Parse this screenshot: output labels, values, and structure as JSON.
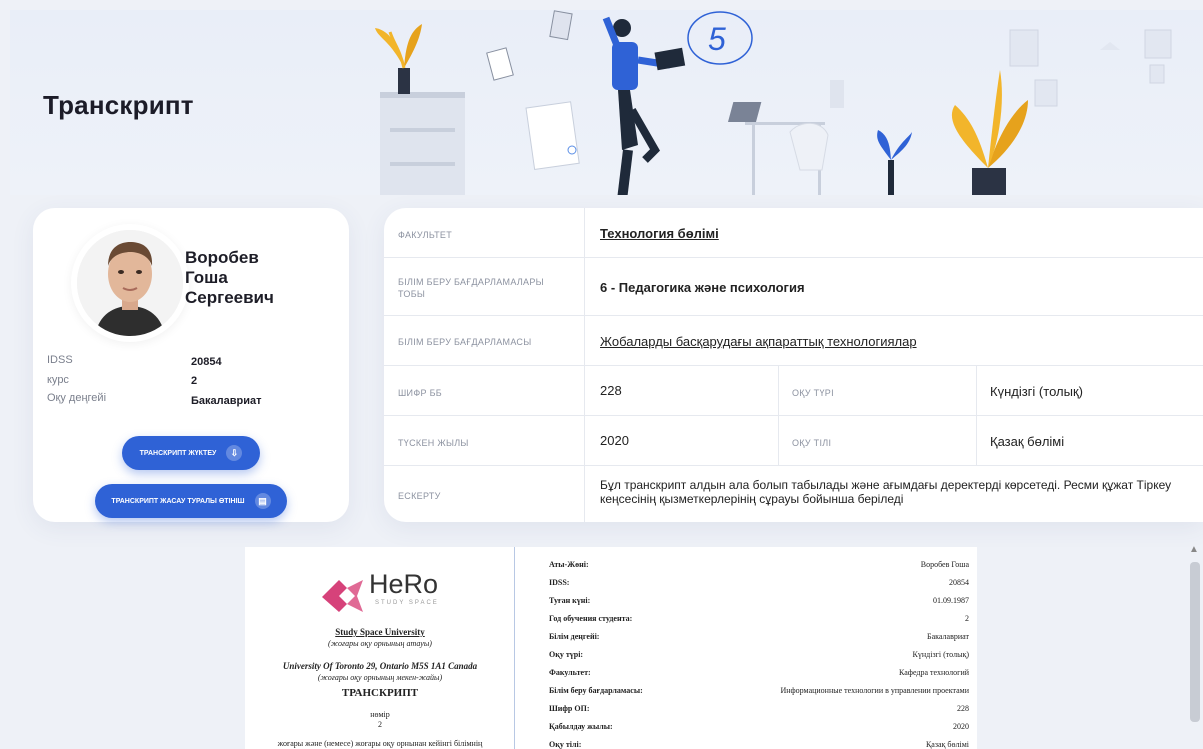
{
  "page": {
    "title": "Транскрипт"
  },
  "profile": {
    "name_line1": "Воробев",
    "name_line2": "Гоша",
    "name_line3": "Сергеевич",
    "fields": [
      {
        "label": "IDSS",
        "value": "20854"
      },
      {
        "label": "курс",
        "value": "2"
      },
      {
        "label": "Оқу деңгейі",
        "value": "Бакалавриат"
      }
    ],
    "download_button": "Транскрипт жүктеу",
    "request_button": "Транскрипт жасау туралы өтініш"
  },
  "details": {
    "faculty_label": "Факультет",
    "faculty_value": "Технология бөлімі",
    "group_label": "Білім беру бағдарламалары тобы",
    "group_value": "6 - Педагогика және психология",
    "program_label": "Білім беру бағдарламасы",
    "program_value": "Жобаларды басқарудағы ақпараттық технологиялар",
    "code_label": "Шифр ББ",
    "code_value": "228",
    "study_type_label": "Оқу түрі",
    "study_type_value": "Күндізгі (толық)",
    "year_label": "Түскен жылы",
    "year_value": "2020",
    "language_label": "Оқу тілі",
    "language_value": "Қазақ бөлімі",
    "note_label": "Ескерту",
    "note_value": "Бұл транскрипт алдын ала болып табылады және ағымдағы деректерді көрсетеді. Ресми құжат Тіркеу кеңсесінің қызметкерлерінің сұрауы бойынша беріледі"
  },
  "document": {
    "logo_text": "HeRo",
    "logo_sub": "STUDY SPACE",
    "university": "Study Space University",
    "university_sub": "(жоғары оқу орнының атауы)",
    "address": "University Of Toronto 29, Ontario M5S 1A1 Canada",
    "address_sub": "(жоғары оқу орнының мекен-жайы)",
    "heading": "ТРАНСКРИПТ",
    "number_label": "нөмір",
    "number_value": "2",
    "footer_line": "жоғары және (немесе) жоғары оқу орнынан кейінгі білімнің",
    "rows": [
      {
        "k": "Аты-Жөні:",
        "v": "Воробев Гоша"
      },
      {
        "k": "IDSS:",
        "v": "20854"
      },
      {
        "k": "Туған күні:",
        "v": "01.09.1987"
      },
      {
        "k": "Год обучения студента:",
        "v": "2"
      },
      {
        "k": "Білім деңгейі:",
        "v": "Бакалавриат"
      },
      {
        "k": "Оқу түрі:",
        "v": "Күндізгі (толық)"
      },
      {
        "k": "Факультет:",
        "v": "Кафедра технологий"
      },
      {
        "k": "Білім беру бағдарламасы:",
        "v": "Информационные технологии в управлении проектами"
      },
      {
        "k": "Шифр ОП:",
        "v": "228"
      },
      {
        "k": "Қабылдау жылы:",
        "v": "2020"
      },
      {
        "k": "Оқу тілі:",
        "v": "Қазақ бөлімі"
      }
    ]
  },
  "colors": {
    "accent": "#2f62d6",
    "background": "#eef1f7",
    "logo_pink": "#d6427a"
  }
}
